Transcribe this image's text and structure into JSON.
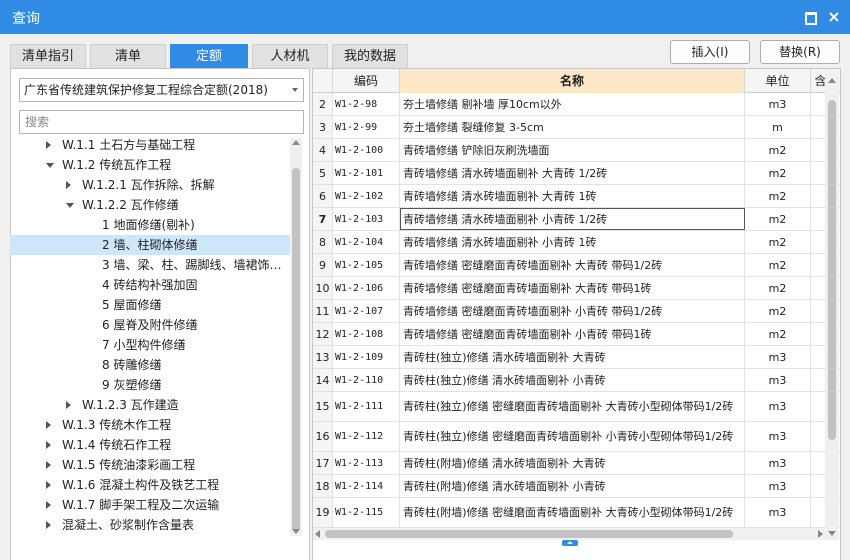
{
  "window": {
    "title": "查询",
    "maximize_icon": "maximize-icon",
    "close_glyph": "×"
  },
  "tabs": [
    {
      "label": "清单指引",
      "active": false
    },
    {
      "label": "清单",
      "active": false
    },
    {
      "label": "定额",
      "active": true
    },
    {
      "label": "人材机",
      "active": false
    },
    {
      "label": "我的数据",
      "active": false
    }
  ],
  "actions": {
    "insert": "插入(I)",
    "replace": "替换(R)"
  },
  "library": {
    "selected": "广东省传统建筑保护修复工程综合定额(2018)"
  },
  "search": {
    "placeholder": "搜索",
    "value": ""
  },
  "tree": [
    {
      "label": "W.1.1 土石方与基础工程",
      "level": 1,
      "toggle": "right",
      "selected": false
    },
    {
      "label": "W.1.2 传统瓦作工程",
      "level": 1,
      "toggle": "down",
      "selected": false
    },
    {
      "label": "W.1.2.1 瓦作拆除、拆解",
      "level": 2,
      "toggle": "right",
      "selected": false
    },
    {
      "label": "W.1.2.2 瓦作修缮",
      "level": 2,
      "toggle": "down",
      "selected": false
    },
    {
      "label": "1 地面修缮(剔补)",
      "level": 3,
      "toggle": "",
      "selected": false
    },
    {
      "label": "2 墙、柱砌体修缮",
      "level": 3,
      "toggle": "",
      "selected": true
    },
    {
      "label": "3 墙、梁、柱、踢脚线、墙裙饰…",
      "level": 3,
      "toggle": "",
      "selected": false
    },
    {
      "label": "4 砖结构补强加固",
      "level": 3,
      "toggle": "",
      "selected": false
    },
    {
      "label": "5 屋面修缮",
      "level": 3,
      "toggle": "",
      "selected": false
    },
    {
      "label": "6 屋脊及附件修缮",
      "level": 3,
      "toggle": "",
      "selected": false
    },
    {
      "label": "7 小型构件修缮",
      "level": 3,
      "toggle": "",
      "selected": false
    },
    {
      "label": "8 砖雕修缮",
      "level": 3,
      "toggle": "",
      "selected": false
    },
    {
      "label": "9 灰塑修缮",
      "level": 3,
      "toggle": "",
      "selected": false
    },
    {
      "label": "W.1.2.3 瓦作建造",
      "level": 2,
      "toggle": "right",
      "selected": false
    },
    {
      "label": "W.1.3 传统木作工程",
      "level": 1,
      "toggle": "right",
      "selected": false
    },
    {
      "label": "W.1.4 传统石作工程",
      "level": 1,
      "toggle": "right",
      "selected": false
    },
    {
      "label": "W.1.5 传统油漆彩画工程",
      "level": 1,
      "toggle": "right",
      "selected": false
    },
    {
      "label": "W.1.6 混凝土构件及铁艺工程",
      "level": 1,
      "toggle": "right",
      "selected": false
    },
    {
      "label": "W.1.7 脚手架工程及二次运输",
      "level": 1,
      "toggle": "right",
      "selected": false
    },
    {
      "label": "混凝土、砂浆制作含量表",
      "level": 1,
      "toggle": "right",
      "selected": false
    }
  ],
  "grid": {
    "columns": {
      "code": "编码",
      "name": "名称",
      "unit": "单位",
      "extra": "含"
    },
    "rows": [
      {
        "idx": "2",
        "code": "W1-2-98",
        "name": "夯土墙修缮 剔补墙 厚10cm以外",
        "unit": "m3"
      },
      {
        "idx": "3",
        "code": "W1-2-99",
        "name": "夯土墙修缮 裂缝修复 3-5cm",
        "unit": "m"
      },
      {
        "idx": "4",
        "code": "W1-2-100",
        "name": "青砖墙修缮 铲除旧灰刷洗墙面",
        "unit": "m2"
      },
      {
        "idx": "5",
        "code": "W1-2-101",
        "name": "青砖墙修缮 清水砖墙面剔补 大青砖 1/2砖",
        "unit": "m2"
      },
      {
        "idx": "6",
        "code": "W1-2-102",
        "name": "青砖墙修缮 清水砖墙面剔补 大青砖 1砖",
        "unit": "m2"
      },
      {
        "idx": "7",
        "code": "W1-2-103",
        "name": "青砖墙修缮 清水砖墙面剔补 小青砖 1/2砖",
        "unit": "m2",
        "current": true
      },
      {
        "idx": "8",
        "code": "W1-2-104",
        "name": "青砖墙修缮 清水砖墙面剔补 小青砖 1砖",
        "unit": "m2"
      },
      {
        "idx": "9",
        "code": "W1-2-105",
        "name": "青砖墙修缮 密缝磨面青砖墙面剔补 大青砖 带码1/2砖",
        "unit": "m2"
      },
      {
        "idx": "10",
        "code": "W1-2-106",
        "name": "青砖墙修缮 密缝磨面青砖墙面剔补 大青砖 带码1砖",
        "unit": "m2"
      },
      {
        "idx": "11",
        "code": "W1-2-107",
        "name": "青砖墙修缮 密缝磨面青砖墙面剔补 小青砖 带码1/2砖",
        "unit": "m2"
      },
      {
        "idx": "12",
        "code": "W1-2-108",
        "name": "青砖墙修缮 密缝磨面青砖墙面剔补 小青砖 带码1砖",
        "unit": "m2"
      },
      {
        "idx": "13",
        "code": "W1-2-109",
        "name": "青砖柱(独立)修缮 清水砖墙面剔补 大青砖",
        "unit": "m3"
      },
      {
        "idx": "14",
        "code": "W1-2-110",
        "name": "青砖柱(独立)修缮 清水砖墙面剔补 小青砖",
        "unit": "m3"
      },
      {
        "idx": "15",
        "code": "W1-2-111",
        "name": "青砖柱(独立)修缮 密缝磨面青砖墙面剔补 大青砖小型砌体带码1/2砖",
        "unit": "m3"
      },
      {
        "idx": "16",
        "code": "W1-2-112",
        "name": "青砖柱(独立)修缮 密缝磨面青砖墙面剔补 小青砖小型砌体带码1/2砖",
        "unit": "m3"
      },
      {
        "idx": "17",
        "code": "W1-2-113",
        "name": "青砖柱(附墙)修缮 清水砖墙面剔补 大青砖",
        "unit": "m3"
      },
      {
        "idx": "18",
        "code": "W1-2-114",
        "name": "青砖柱(附墙)修缮 清水砖墙面剔补 小青砖",
        "unit": "m3"
      },
      {
        "idx": "19",
        "code": "W1-2-115",
        "name": "青砖柱(附墙)修缮 密缝磨面青砖墙面剔补 大青砖小型砌体带码1/2砖",
        "unit": "m3"
      }
    ]
  },
  "colors": {
    "accent": "#2f8be4",
    "selected_row": "#cde6fa",
    "name_header": "#fde9c8"
  }
}
